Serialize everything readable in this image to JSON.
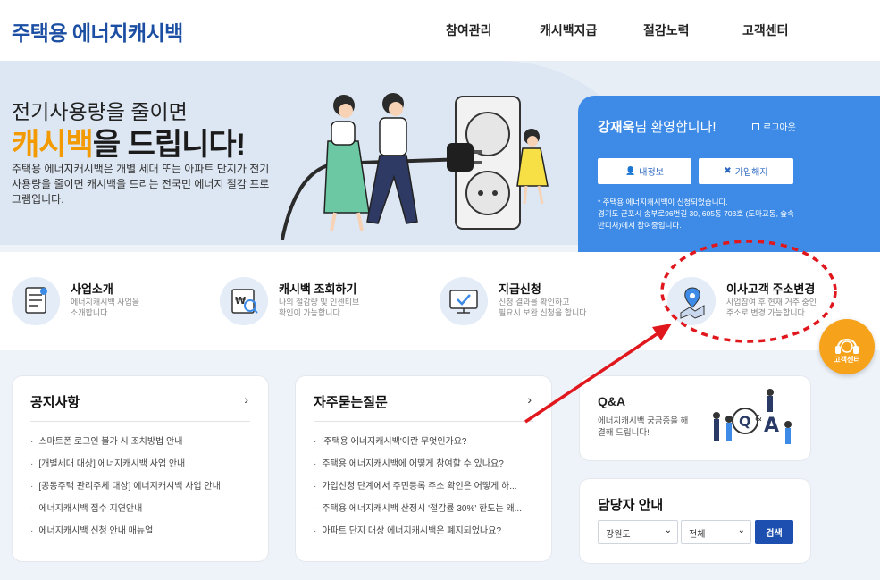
{
  "header": {
    "logo": "주택용 에너지캐시백",
    "nav": [
      "참여관리",
      "캐시백지급",
      "절감노력",
      "고객센터"
    ]
  },
  "hero": {
    "title_line1": "전기사용량을 줄이면",
    "title_highlight": "캐시백",
    "title_rest": "을 드립니다!",
    "desc": "주택용 에너지캐시백은 개별 세대 또는 아파트 단지가 전기사용량을 줄이면 캐시백을 드리는 전국민 에너지 절감 프로그램입니다."
  },
  "login_panel": {
    "user_name": "강재욱",
    "welcome_suffix": "님 환영합니다!",
    "logout_label": "로그아웃",
    "my_info_label": "내정보",
    "cancel_label": "가입해지",
    "notice_line1": "* 주택용 에너지캐시백이 신청되었습니다.",
    "notice_line2": "경기도 군포시 송부로96번길 30, 605동 703호 (도마교동, 숲속반디처)에서 참여중입니다."
  },
  "quick_menu": [
    {
      "title": "사업소개",
      "desc1": "에너지캐시백 사업을",
      "desc2": "소개합니다."
    },
    {
      "title": "캐시백 조회하기",
      "desc1": "나의 절감량 및 인센티브",
      "desc2": "확인이 가능합니다."
    },
    {
      "title": "지급신청",
      "desc1": "신청 결과를 확인하고",
      "desc2": "필요시 보완 신청을 합니다."
    },
    {
      "title": "이사고객 주소변경",
      "desc1": "사업참여 후 현재 거주 중인",
      "desc2": "주소로 변경 가능합니다."
    }
  ],
  "fab_label": "고객센터",
  "notices": {
    "title": "공지사항",
    "more": "›",
    "items": [
      "스마트폰 로그인 불가 시 조치방법 안내",
      "[개별세대 대상] 에너지캐시백 사업 안내",
      "[공동주택 관리주체 대상] 에너지캐시백 사업 안내",
      "에너지캐시백 접수 지연안내",
      "에너지캐시백 신청 안내 매뉴얼"
    ]
  },
  "faq": {
    "title": "자주묻는질문",
    "more": "›",
    "items": [
      "'주택용 에너지캐시백'이란 무엇인가요?",
      "주택용 에너지캐시백에 어떻게 참여할 수 있나요?",
      "가입신청 단계에서 주민등록 주소 확인은 어떻게 하...",
      "주택용 에너지캐시백 산정시 '절감률 30%' 한도는 왜...",
      "아파트 단지 대상 에너지캐시백은 폐지되었나요?"
    ]
  },
  "qa": {
    "title": "Q&A",
    "desc": "에너지캐시백 궁금증을 해결해 드립니다!"
  },
  "manager": {
    "title": "담당자 안내",
    "region": "강원도",
    "district": "전체",
    "search_label": "검색"
  },
  "colors": {
    "brand": "#1c4fa3",
    "accent": "#f29a00",
    "panel": "#3d8be6",
    "annotation": "#e0171d"
  }
}
